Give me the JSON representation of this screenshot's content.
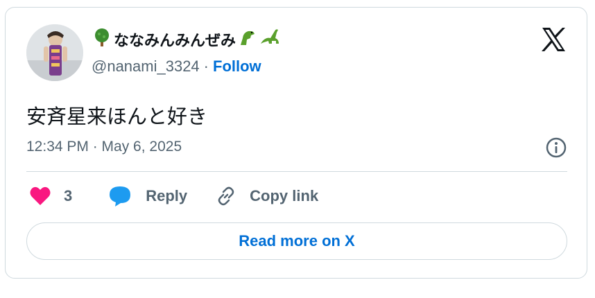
{
  "author": {
    "display_name": "ななみんみんぜみ",
    "leading_emoji": "tree-icon",
    "trailing_emoji": [
      "t-rex-icon",
      "sauropod-icon"
    ],
    "handle": "@nanami_3324",
    "separator": "·",
    "follow_label": "Follow"
  },
  "tweet": {
    "text": "安斉星来ほんと好き",
    "timestamp": "12:34 PM · May 6, 2025"
  },
  "actions": {
    "like_count": "3",
    "reply_label": "Reply",
    "copy_link_label": "Copy link"
  },
  "footer": {
    "read_more_label": "Read more on X"
  },
  "colors": {
    "like_pink": "#f91880",
    "reply_blue": "#1d9bf0",
    "link_blue": "#006fd6",
    "muted_gray": "#536471",
    "border": "#cfd9de"
  },
  "icons": {
    "platform_logo": "x-logo-icon",
    "info": "info-icon",
    "copy": "link-icon"
  }
}
